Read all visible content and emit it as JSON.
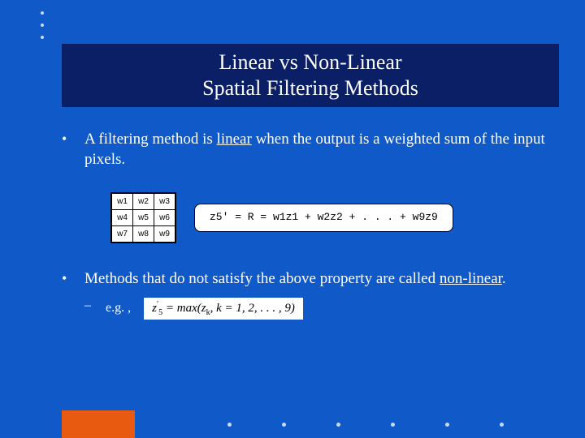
{
  "title": {
    "line1": "Linear vs Non-Linear",
    "line2": "Spatial Filtering Methods"
  },
  "bullet1": {
    "pre": "A filtering method is ",
    "underlined": "linear",
    "post": " when the output is a weighted sum of the input pixels."
  },
  "grid": {
    "r1": [
      "w1",
      "w2",
      "w3"
    ],
    "r2": [
      "w4",
      "w5",
      "w6"
    ],
    "r3": [
      "w7",
      "w8",
      "w9"
    ]
  },
  "equation": "z5' = R = w1z1 + w2z2 + . . . + w9z9",
  "bullet2": {
    "pre": "Methods that do not satisfy the above property are called ",
    "underlined": "non-linear",
    "post": "."
  },
  "sub": {
    "label": "e.g. ,",
    "eq_head": "z",
    "eq_sub1": "5",
    "eq_sup": "′",
    "eq_mid": " = max(z",
    "eq_sub2": "k",
    "eq_tail": ", k = 1, 2, . . . , 9)"
  }
}
